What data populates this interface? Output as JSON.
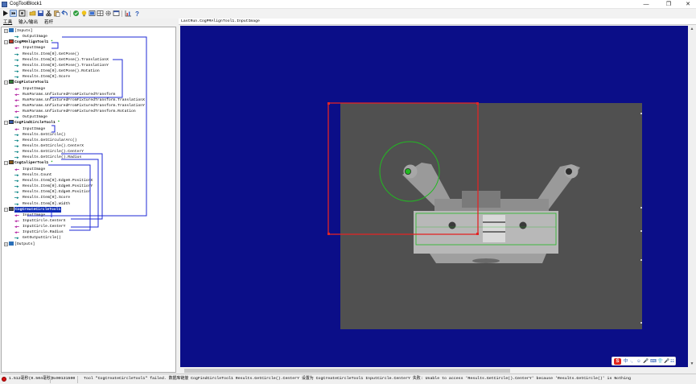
{
  "window": {
    "title": "CogToolBlock1",
    "minimize": "—",
    "maximize": "❐",
    "close": "✕"
  },
  "tabs": [
    "工具",
    "输入/输出",
    "若杆"
  ],
  "tree": {
    "rows": [
      {
        "text": "[Inputs]",
        "kind": "group"
      },
      {
        "text": "OutputImage",
        "kind": "out"
      },
      {
        "text": "CogPMAlignTool1",
        "kind": "tool",
        "star": "*"
      },
      {
        "text": "InputImage",
        "kind": "in"
      },
      {
        "text": "Results.Item[0].GetPose()",
        "kind": "out"
      },
      {
        "text": "Results.Item[0].GetPose().TranslationX",
        "kind": "out"
      },
      {
        "text": "Results.Item[0].GetPose().TranslationY",
        "kind": "out"
      },
      {
        "text": "Results.Item[0].GetPose().Rotation",
        "kind": "out"
      },
      {
        "text": "Results.Item[0].Score",
        "kind": "out"
      },
      {
        "text": "CogFixtureTool1",
        "kind": "tool",
        "star": ""
      },
      {
        "text": "InputImage",
        "kind": "in"
      },
      {
        "text": "RunParams.UnfixturedFromFixturedTransform",
        "kind": "in"
      },
      {
        "text": "RunParams.UnfixturedFromFixturedTransform.TranslationX",
        "kind": "in"
      },
      {
        "text": "RunParams.UnfixturedFromFixturedTransform.TranslationY",
        "kind": "in"
      },
      {
        "text": "RunParams.UnfixturedFromFixturedTransform.Rotation",
        "kind": "in"
      },
      {
        "text": "OutputImage",
        "kind": "out"
      },
      {
        "text": "CogFindCircleTool1",
        "kind": "tool",
        "star": "*"
      },
      {
        "text": "InputImage",
        "kind": "in"
      },
      {
        "text": "Results.GetCircle()",
        "kind": "out"
      },
      {
        "text": "Results.GetCircularArc()",
        "kind": "out"
      },
      {
        "text": "Results.GetCircle().CenterX",
        "kind": "out"
      },
      {
        "text": "Results.GetCircle().CenterY",
        "kind": "out"
      },
      {
        "text": "Results.GetCircle().Radius",
        "kind": "out"
      },
      {
        "text": "CogCaliperTool1",
        "kind": "tool",
        "star": "*"
      },
      {
        "text": "InputImage",
        "kind": "in"
      },
      {
        "text": "Results.Count",
        "kind": "out"
      },
      {
        "text": "Results.Item[0].Edge0.PositionX",
        "kind": "out"
      },
      {
        "text": "Results.Item[0].Edge0.PositionY",
        "kind": "out"
      },
      {
        "text": "Results.Item[0].Edge0.Position",
        "kind": "out"
      },
      {
        "text": "Results.Item[0].Score",
        "kind": "out"
      },
      {
        "text": "Results.Item[0].Width",
        "kind": "out"
      },
      {
        "text": "CogCreateCircleTool1",
        "kind": "tool-sel",
        "star": ""
      },
      {
        "text": "InputImage",
        "kind": "in"
      },
      {
        "text": "InputCircle.CenterX",
        "kind": "in"
      },
      {
        "text": "InputCircle.CenterY",
        "kind": "in"
      },
      {
        "text": "InputCircle.Radius",
        "kind": "in"
      },
      {
        "text": "GetOutputCircle()",
        "kind": "out"
      },
      {
        "text": "[Outputs]",
        "kind": "group"
      }
    ]
  },
  "image_view": {
    "header": "LastRun.CogPMAlignTool1.InputImage"
  },
  "ime": {
    "logo": "S",
    "items": [
      "中",
      "·,",
      "☺",
      "🎤",
      "⌨",
      "👕",
      "🎤",
      "☷"
    ]
  },
  "statusbar": {
    "time": "1.512毫秒(0.504毫秒)",
    "hex": "0x00131500",
    "message": "Tool \"CogCreateCircleTool1\" failed. 数据库链接 CogFindCircleTool1 Results.GetCircle().CenterY 设置为 CogCreateCircleTool1 InputCircle.CenterY 失败: Unable to access 'Results.GetCircle().CenterY' because 'Results.GetCircle()' is Nothing"
  },
  "colors": {
    "display_bg": "#0b0e88",
    "link": "#1c28d6",
    "input_arrow": "#b0189c",
    "output_arrow": "#108888",
    "region_red": "#e22525",
    "region_green": "#22b822",
    "selection": "#0a2ab4"
  }
}
